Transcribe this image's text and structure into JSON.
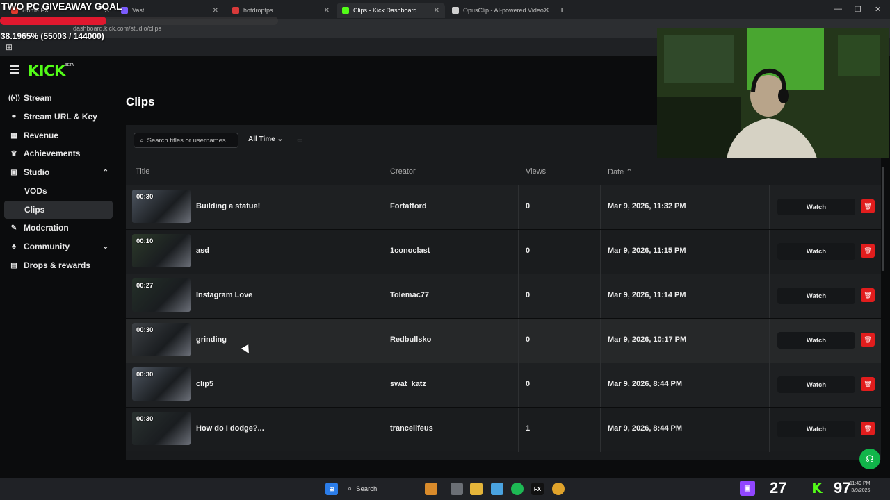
{
  "browser": {
    "tabs": [
      {
        "label": "Home FX",
        "favicon_color": "#e23b2e"
      },
      {
        "label": "Vast",
        "favicon_color": "#7b5cff"
      },
      {
        "label": "hotdropfps",
        "favicon_color": "#d83a3a"
      },
      {
        "label": "Clips - Kick Dashboard",
        "favicon_color": "#53fc18"
      },
      {
        "label": "OpusClip - AI-powered Video R",
        "favicon_color": "#cfcfcf"
      }
    ],
    "url": "dashboard.kick.com/studio/clips"
  },
  "overlay": {
    "goal_title": "TWO PC GIVEAWAY GOAL",
    "goal_progress_text": "38.1965% (55003 / 144000)",
    "goal_fraction": 0.381965,
    "goal_color": "#e0182e",
    "count_left": "27",
    "count_right": "97"
  },
  "brand": {
    "logo": "KICK",
    "beta": "BETA",
    "accent": "#53fc18"
  },
  "sidebar": {
    "items": [
      {
        "label": "Stream",
        "icon": "broadcast-icon",
        "glyph": "((•))"
      },
      {
        "label": "Stream URL & Key",
        "icon": "link-icon",
        "glyph": "⚭"
      },
      {
        "label": "Revenue",
        "icon": "revenue-icon",
        "glyph": "▦"
      },
      {
        "label": "Achievements",
        "icon": "trophy-icon",
        "glyph": "♛"
      },
      {
        "label": "Studio",
        "icon": "studio-icon",
        "glyph": "▣",
        "chevron": "⌃"
      },
      {
        "label": "VODs"
      },
      {
        "label": "Clips"
      },
      {
        "label": "Moderation",
        "icon": "wrench-icon",
        "glyph": "✎"
      },
      {
        "label": "Community",
        "icon": "community-icon",
        "glyph": "♣",
        "chevron": "⌄"
      },
      {
        "label": "Drops & rewards",
        "icon": "gift-icon",
        "glyph": "▤"
      }
    ]
  },
  "main": {
    "title": "Clips",
    "search_placeholder": "Search titles or usernames",
    "time_filter": "All Time",
    "columns": {
      "title": "Title",
      "creator": "Creator",
      "views": "Views",
      "date": "Date"
    },
    "watch_label": "Watch",
    "rows": [
      {
        "duration": "00:30",
        "title": "Building a statue!",
        "creator": "Fortafford",
        "views": "0",
        "date": "Mar 9, 2026, 11:32 PM"
      },
      {
        "duration": "00:10",
        "title": "asd",
        "creator": "1conoclast",
        "views": "0",
        "date": "Mar 9, 2026, 11:15 PM"
      },
      {
        "duration": "00:27",
        "title": "Instagram Love",
        "creator": "Tolemac77",
        "views": "0",
        "date": "Mar 9, 2026, 11:14 PM"
      },
      {
        "duration": "00:30",
        "title": "grinding",
        "creator": "Redbullsko",
        "views": "0",
        "date": "Mar 9, 2026, 10:17 PM"
      },
      {
        "duration": "00:30",
        "title": "clip5",
        "creator": "swat_katz",
        "views": "0",
        "date": "Mar 9, 2026, 8:44 PM"
      },
      {
        "duration": "00:30",
        "title": "How do I dodge?...",
        "creator": "trancelifeus",
        "views": "1",
        "date": "Mar 9, 2026, 8:44 PM"
      }
    ]
  },
  "taskbar": {
    "search": "Search",
    "clock_time": "11:49 PM",
    "clock_date": "3/9/2026"
  }
}
